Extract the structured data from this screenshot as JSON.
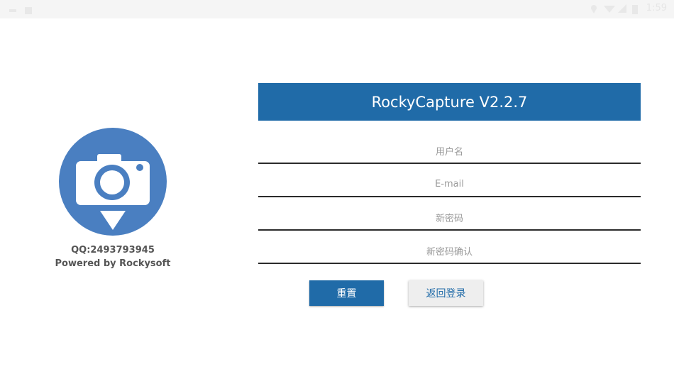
{
  "status_bar": {
    "time": "1:59",
    "icons": [
      "notification-icon",
      "image-icon",
      "location-icon",
      "wifi-icon",
      "signal-icon",
      "battery-icon"
    ]
  },
  "brand": {
    "logo_icon": "camera-pin-icon",
    "qq": "QQ:2493793945",
    "powered_by": "Powered by Rockysoft"
  },
  "form": {
    "title": "RockyCapture V2.2.7",
    "username_placeholder": "用户名",
    "email_placeholder": "E-mail",
    "new_password_placeholder": "新密码",
    "confirm_password_placeholder": "新密码确认",
    "reset_label": "重置",
    "back_to_login_label": "返回登录"
  },
  "colors": {
    "accent": "#206ba8",
    "logo_blue": "#4a7fc1",
    "secondary_button": "#eeeeee",
    "placeholder": "#9a9a9a"
  }
}
